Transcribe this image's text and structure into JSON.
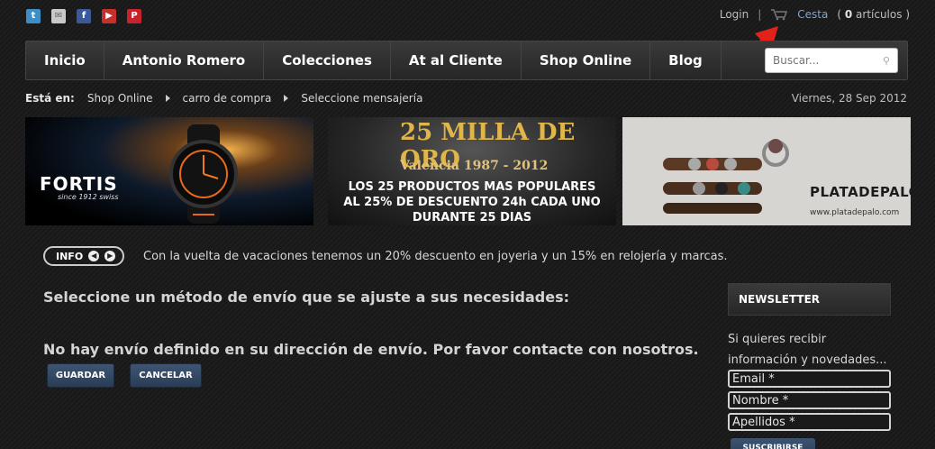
{
  "social": {
    "icons": [
      "twitter-icon",
      "mail-icon",
      "facebook-icon",
      "youtube-icon",
      "pinterest-icon"
    ]
  },
  "top": {
    "login": "Login",
    "sep": "|",
    "cart": "Cesta",
    "items_count": "0",
    "items_label": "artículos"
  },
  "nav": {
    "items": [
      "Inicio",
      "Antonio Romero",
      "Colecciones",
      "At al Cliente",
      "Shop Online",
      "Blog"
    ],
    "search_placeholder": "Buscar..."
  },
  "breadcrumb": {
    "label": "Está en:",
    "items": [
      "Shop Online",
      "carro de compra",
      "Seleccione mensajería"
    ]
  },
  "date": "Viernes, 28 Sep 2012",
  "banners": {
    "fortis": {
      "brand": "FORTIS",
      "sub": "since 1912 swiss"
    },
    "milla": {
      "headline": "25 MILLA DE ORO",
      "city": "Valencia 1987 - 2012",
      "line1": "LOS 25 PRODUCTOS MAS POPULARES",
      "line2": "AL 25% DE DESCUENTO 24h CADA UNO",
      "line3": "DURANTE 25 DIAS"
    },
    "plata": {
      "brand": "PLATADEPALO",
      "url": "www.platadepalo.com"
    }
  },
  "info": {
    "label": "INFO",
    "text": "Con la vuelta de vacaciones tenemos un 20% descuento en joyeria y un 15% en relojería y marcas."
  },
  "content": {
    "heading": "Seleccione un método de envío que se ajuste a sus necesidades:",
    "message": "No hay envío definido en su dirección de envío. Por favor contacte con nosotros.",
    "save": "GUARDAR",
    "cancel": "CANCELAR"
  },
  "newsletter": {
    "title": "NEWSLETTER",
    "text": "Si quieres recibir información y novedades...",
    "email": "Email *",
    "name": "Nombre *",
    "surname": "Apellidos *",
    "subscribe": "SUSCRIBIRSE"
  },
  "colors": {
    "accent": "#3d5573",
    "link": "#7aa6cf",
    "arrow": "#e0221b"
  }
}
